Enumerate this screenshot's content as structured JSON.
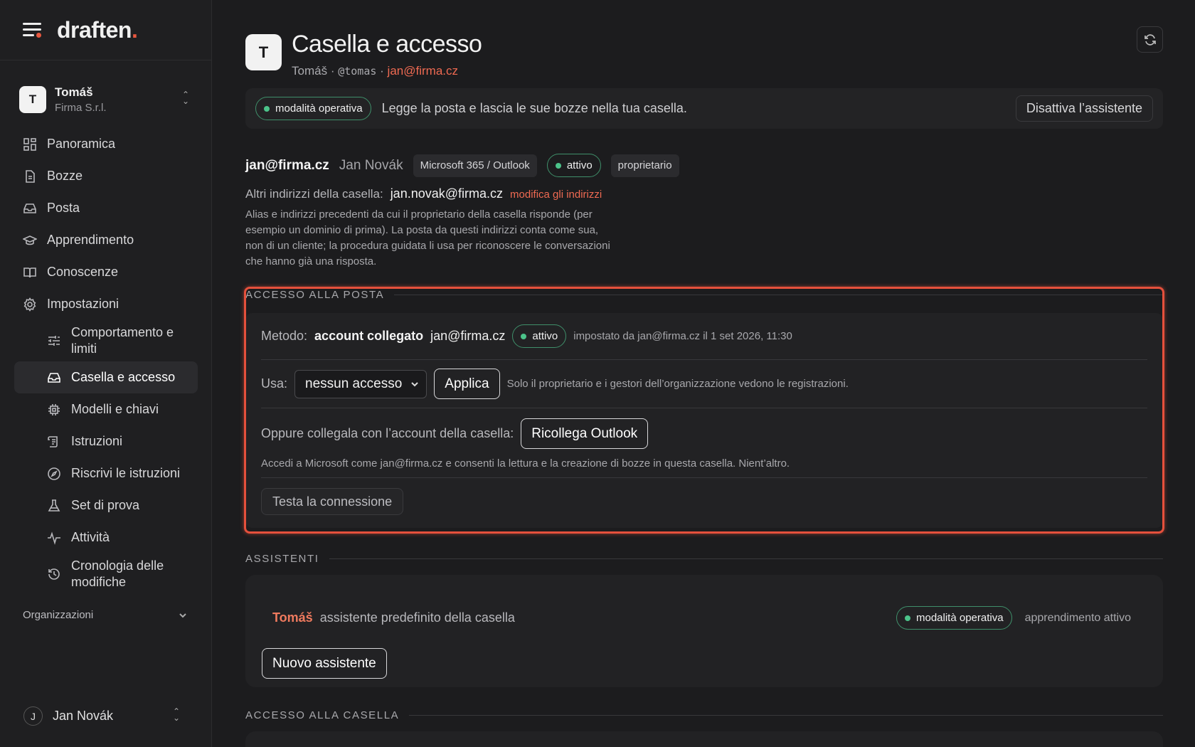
{
  "sidebar": {
    "brand": {
      "text": "draften",
      "accent": "."
    },
    "account": {
      "initial": "T",
      "name": "Tomáš",
      "org": "Firma S.r.l."
    },
    "nav": [
      {
        "label": "Panoramica",
        "icon": "dashboard-icon"
      },
      {
        "label": "Bozze",
        "icon": "document-icon"
      },
      {
        "label": "Posta",
        "icon": "inbox-icon"
      },
      {
        "label": "Apprendimento",
        "icon": "graduation-cap-icon"
      },
      {
        "label": "Conoscenze",
        "icon": "book-icon"
      },
      {
        "label": "Impostazioni",
        "icon": "gear-icon"
      }
    ],
    "subnav": [
      {
        "label": "Comportamento e limiti",
        "icon": "sliders-icon"
      },
      {
        "label": "Casella e accesso",
        "icon": "inbox-icon",
        "active": true
      },
      {
        "label": "Modelli e chiavi",
        "icon": "chip-icon"
      },
      {
        "label": "Istruzioni",
        "icon": "scroll-icon"
      },
      {
        "label": "Riscrivi le istruzioni",
        "icon": "compass-icon"
      },
      {
        "label": "Set di prova",
        "icon": "flask-icon"
      },
      {
        "label": "Attività",
        "icon": "activity-icon"
      },
      {
        "label": "Cronologia delle modifiche",
        "icon": "history-icon"
      }
    ],
    "organizations_label": "Organizzazioni",
    "user": {
      "initial": "J",
      "name": "Jan Novák"
    }
  },
  "header": {
    "initial": "T",
    "title": "Casella e accesso",
    "sub_name": "Tomáš",
    "sub_sep": "·",
    "sub_handle": "@tomas",
    "sub_email": "jan@firma.cz"
  },
  "mode_bar": {
    "status": "modalità operativa",
    "text": "Legge la posta e lascia le sue bozze nella tua casella.",
    "button": "Disattiva l’assistente"
  },
  "mailbox": {
    "email": "jan@firma.cz",
    "owner": "Jan Novák",
    "provider": "Microsoft 365 / Outlook",
    "status": "attivo",
    "role": "proprietario",
    "alias_label": "Altri indirizzi della casella:",
    "alias_value": "jan.novak@firma.cz",
    "alias_edit": "modifica gli indirizzi",
    "alias_desc": "Alias e indirizzi precedenti da cui il proprietario della casella risponde (per esempio un dominio di prima). La posta da questi indirizzi conta come sua, non di un cliente; la procedura guidata li usa per riconoscere le conversazioni che hanno già una risposta."
  },
  "mail_access": {
    "section": "ACCESSO ALLA POSTA",
    "method_label": "Metodo:",
    "method_value": "account collegato",
    "method_email": "jan@firma.cz",
    "method_status": "attivo",
    "method_meta": "impostato da jan@firma.cz il 1 set 2026, 11:30",
    "use_label": "Usa:",
    "use_selected": "nessun accesso",
    "apply_button": "Applica",
    "use_note": "Solo il proprietario e i gestori dell’organizzazione vedono le registrazioni.",
    "reconnect_label": "Oppure collegala con l’account della casella:",
    "reconnect_button": "Ricollega Outlook",
    "reconnect_note": "Accedi a Microsoft come jan@firma.cz e consenti la lettura e la creazione di bozze in questa casella. Nient’altro.",
    "test_button": "Testa la connessione"
  },
  "assistants": {
    "section": "ASSISTENTI",
    "name": "Tomáš",
    "desc": "assistente predefinito della casella",
    "status": "modalità operativa",
    "learning": "apprendimento attivo",
    "new_button": "Nuovo assistente"
  },
  "mailbox_access": {
    "section": "ACCESSO ALLA CASELLA"
  },
  "colors": {
    "accent": "#e8573f",
    "success": "#4cc38a",
    "background": "#1c1c1e",
    "highlight": "#e5503c"
  }
}
